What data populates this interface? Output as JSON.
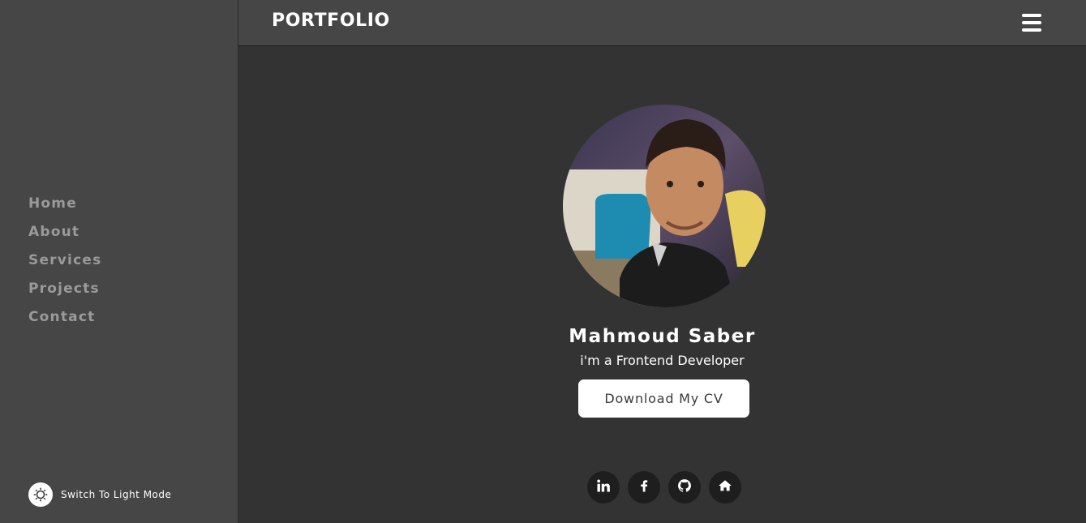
{
  "sidebar": {
    "nav_items": [
      {
        "label": "Home"
      },
      {
        "label": "About"
      },
      {
        "label": "Services"
      },
      {
        "label": "Projects"
      },
      {
        "label": "Contact"
      }
    ],
    "mode_toggle": {
      "label": "Switch To Light Mode",
      "icon": "sun-icon"
    }
  },
  "header": {
    "brand": "PORTFOLIO",
    "menu_icon": "hamburger-menu-icon"
  },
  "hero": {
    "name": "Mahmoud Saber",
    "tagline": "i'm a Frontend Developer",
    "cv_button": "Download My CV"
  },
  "social_links": [
    {
      "icon": "linkedin-icon"
    },
    {
      "icon": "facebook-icon"
    },
    {
      "icon": "github-icon"
    },
    {
      "icon": "home-icon"
    }
  ],
  "colors": {
    "sidebar_bg": "#464646",
    "page_bg": "#333333",
    "nav_text": "#9a9a9a",
    "social_bg": "#1e1e1e"
  }
}
